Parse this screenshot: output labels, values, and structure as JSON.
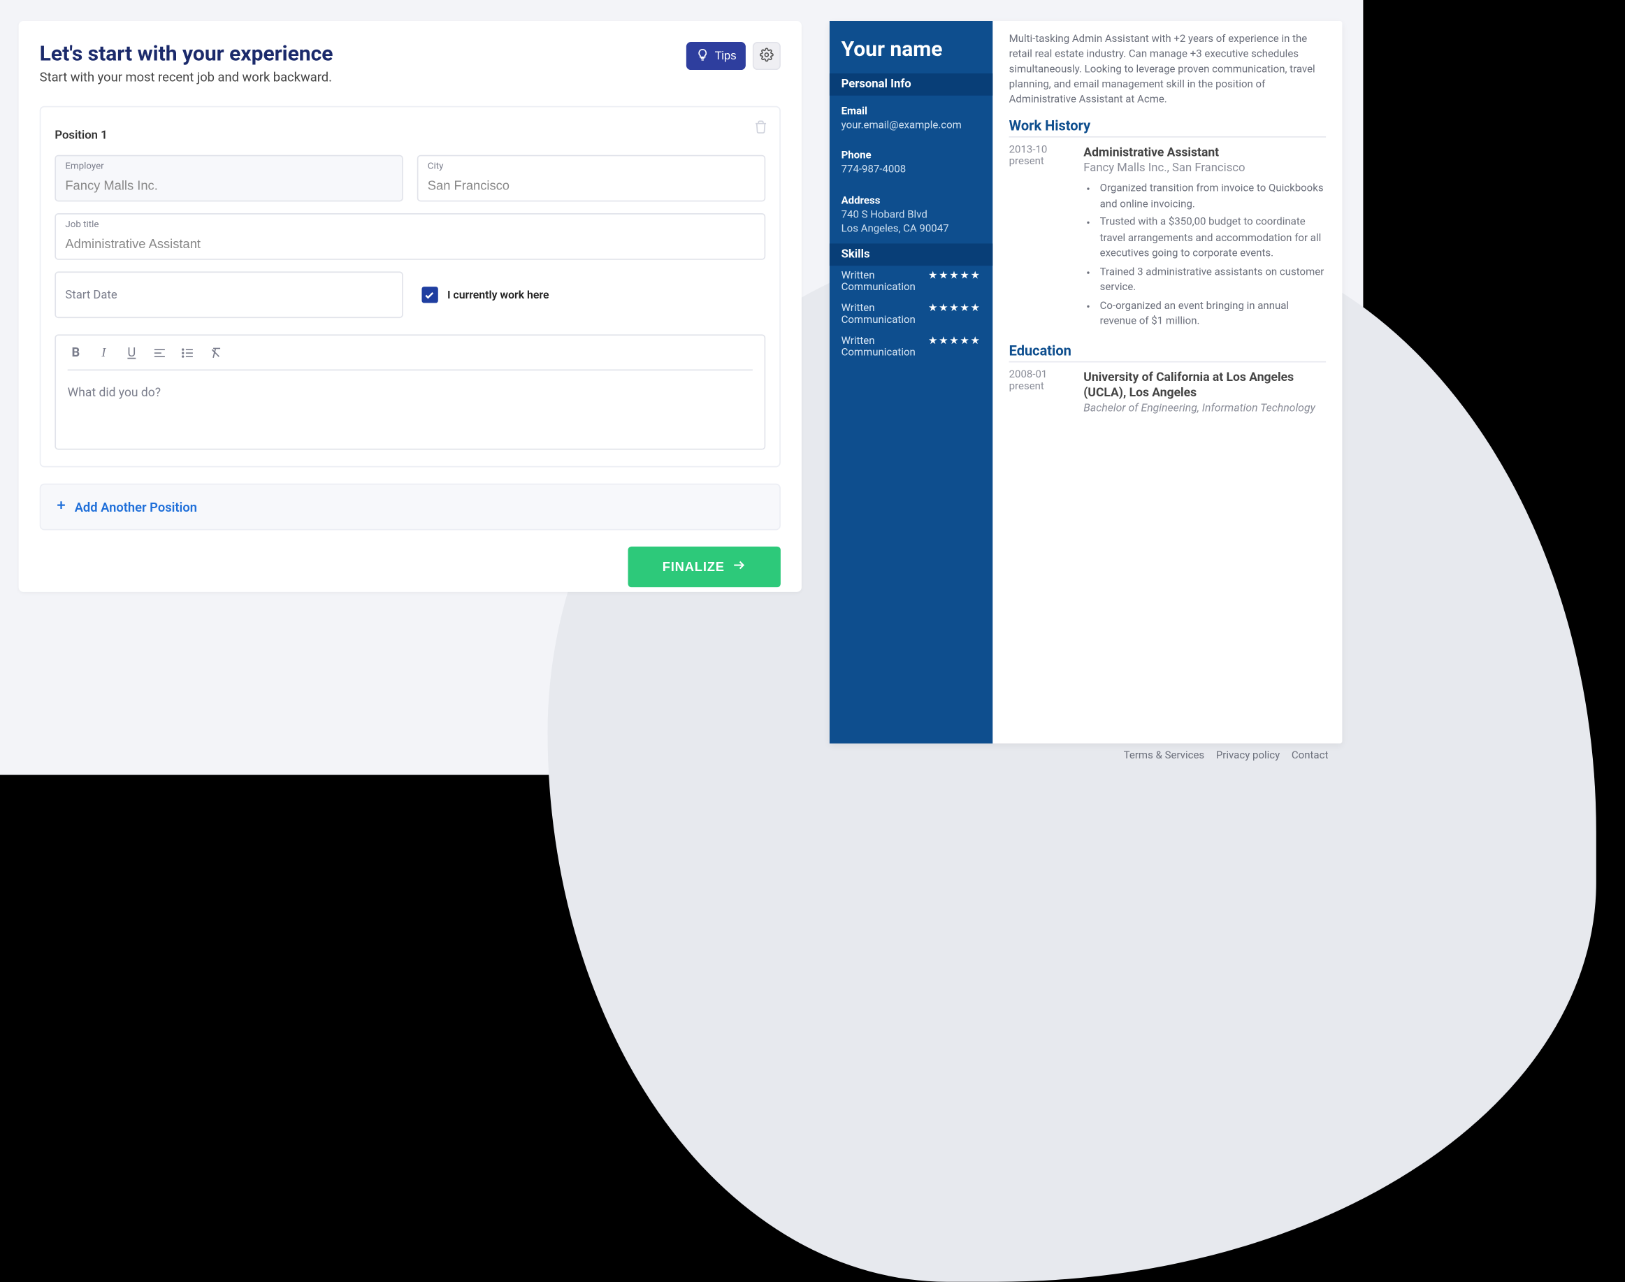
{
  "header": {
    "title": "Let's start with your experience",
    "subtitle": "Start with your most recent job and work backward.",
    "tips_label": "Tips"
  },
  "position": {
    "label": "Position 1",
    "employer_label": "Employer",
    "employer_value": "Fancy Malls Inc.",
    "city_label": "City",
    "city_value": "San Francisco",
    "jobtitle_label": "Job title",
    "jobtitle_value": "Administrative Assistant",
    "startdate_label": "Start Date",
    "startdate_value": "",
    "currently_work_label": "I currently work here",
    "currently_work_checked": true,
    "editor_placeholder": "What did you do?"
  },
  "actions": {
    "add_another": "Add Another Position",
    "finalize": "FINALIZE"
  },
  "preview": {
    "name": "Your name",
    "sections": {
      "personal": "Personal Info",
      "skills": "Skills",
      "work": "Work History",
      "education": "Education"
    },
    "contact": {
      "email_label": "Email",
      "email_value": "your.email@example.com",
      "phone_label": "Phone",
      "phone_value": "774-987-4008",
      "address_label": "Address",
      "address_line1": "740 S Hobard Blvd",
      "address_line2": "Los Angeles, CA 90047"
    },
    "skills": [
      {
        "name": "Written Communication",
        "stars": "★★★★★"
      },
      {
        "name": "Written Communication",
        "stars": "★★★★★"
      },
      {
        "name": "Written Communication",
        "stars": "★★★★★"
      }
    ],
    "summary": "Multi-tasking Admin Assistant with +2 years of experience in the retail real estate industry. Can manage +3 executive schedules simultaneously. Looking to leverage proven communication, travel planning, and email management skill in the position of Administrative Assistant at Acme.",
    "work": {
      "dates": "2013-10 present",
      "role": "Administrative Assistant",
      "org": "Fancy Malls Inc., San Francisco",
      "bullets": [
        "Organized transition from invoice to Quickbooks and online invoicing.",
        "Trusted with a $350,00 budget to coordinate travel arrangements and accommodation for all executives going to corporate events.",
        "Trained 3 administrative assistants on customer service.",
        "Co-organized an event bringing in annual revenue of $1 million."
      ]
    },
    "education": {
      "dates": "2008-01 present",
      "school": "University of California at Los Angeles (UCLA), Los Angeles",
      "degree": "Bachelor of Engineering, Information Technology"
    }
  },
  "footer": {
    "terms": "Terms & Services",
    "privacy": "Privacy policy",
    "contact": "Contact"
  }
}
